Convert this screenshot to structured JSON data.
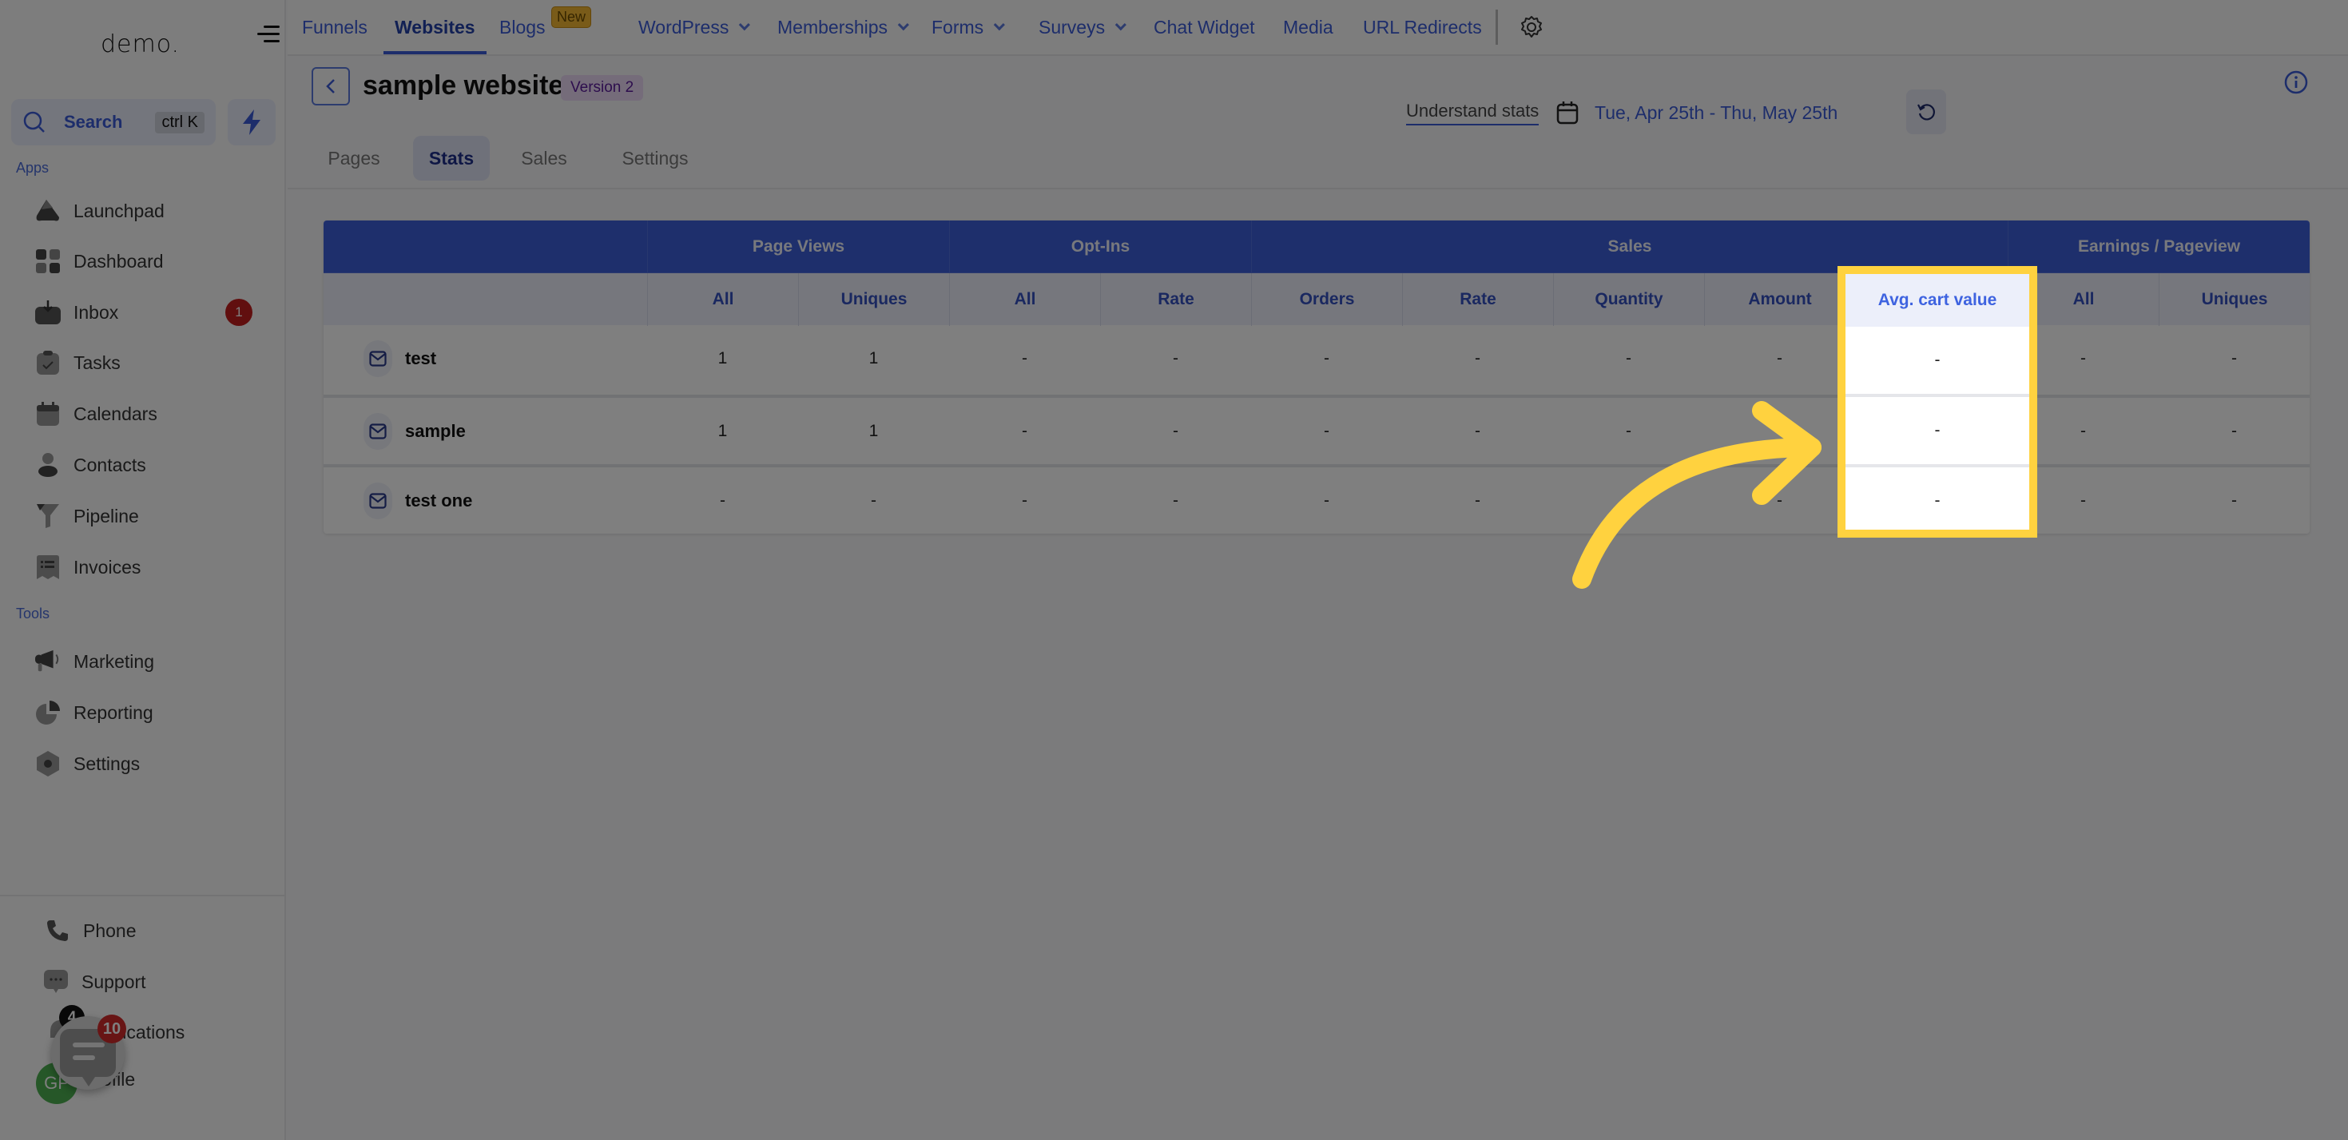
{
  "sidebar": {
    "logo": "demo.",
    "search": {
      "label": "Search",
      "shortcut": "ctrl K"
    },
    "sections": {
      "apps": "Apps",
      "tools": "Tools"
    },
    "apps": [
      {
        "label": "Launchpad",
        "icon": "rocket-icon"
      },
      {
        "label": "Dashboard",
        "icon": "dashboard-grid-icon"
      },
      {
        "label": "Inbox",
        "icon": "inbox-icon",
        "badge": "1"
      },
      {
        "label": "Tasks",
        "icon": "clipboard-check-icon"
      },
      {
        "label": "Calendars",
        "icon": "calendar-icon"
      },
      {
        "label": "Contacts",
        "icon": "person-icon"
      },
      {
        "label": "Pipeline",
        "icon": "funnel-icon"
      },
      {
        "label": "Invoices",
        "icon": "invoice-icon"
      }
    ],
    "tools": [
      {
        "label": "Marketing",
        "icon": "megaphone-icon"
      },
      {
        "label": "Reporting",
        "icon": "pie-chart-icon"
      },
      {
        "label": "Settings",
        "icon": "gear-hex-icon"
      }
    ],
    "bottom": [
      {
        "label": "Phone",
        "icon": "phone-icon"
      },
      {
        "label": "Support",
        "icon": "chat-dots-icon"
      },
      {
        "label": "Notifications",
        "icon": "bell-icon",
        "badge": "4"
      },
      {
        "label": "Profile",
        "icon": "avatar"
      }
    ],
    "avatar_initials": "GP",
    "chat_widget_badge": "10"
  },
  "topnav": {
    "items": [
      {
        "label": "Funnels"
      },
      {
        "label": "Websites",
        "active": true
      },
      {
        "label": "Blogs",
        "badge": "New"
      },
      {
        "label": "WordPress",
        "dropdown": true
      },
      {
        "label": "Memberships",
        "dropdown": true
      },
      {
        "label": "Forms",
        "dropdown": true
      },
      {
        "label": "Surveys",
        "dropdown": true
      },
      {
        "label": "Chat Widget"
      },
      {
        "label": "Media"
      },
      {
        "label": "URL Redirects"
      }
    ]
  },
  "page": {
    "title": "sample website",
    "version_badge": "Version 2",
    "tabs": [
      "Pages",
      "Stats",
      "Sales",
      "Settings"
    ],
    "active_tab": "Stats",
    "understand_stats": "Understand stats",
    "date_range": "Tue, Apr 25th - Thu, May 25th"
  },
  "table": {
    "groups": [
      "Page Views",
      "Opt-Ins",
      "Sales",
      "Earnings / Pageview"
    ],
    "columns": [
      "All",
      "Uniques",
      "All",
      "Rate",
      "Orders",
      "Rate",
      "Quantity",
      "Amount",
      "Avg. cart value",
      "All",
      "Uniques"
    ],
    "rows": [
      {
        "name": "test",
        "values": [
          "1",
          "1",
          "-",
          "-",
          "-",
          "-",
          "-",
          "-",
          "-",
          "-",
          "-"
        ]
      },
      {
        "name": "sample",
        "values": [
          "1",
          "1",
          "-",
          "-",
          "-",
          "-",
          "-",
          "-",
          "-",
          "-",
          "-"
        ]
      },
      {
        "name": "test one",
        "values": [
          "-",
          "-",
          "-",
          "-",
          "-",
          "-",
          "-",
          "-",
          "-",
          "-",
          "-"
        ]
      }
    ],
    "highlighted_column": "Avg. cart value"
  },
  "colors": {
    "accent": "#3b5bd6",
    "header_band": "#3c5fd9",
    "highlight": "#ffd23f",
    "badge_red": "#c21f1f"
  }
}
